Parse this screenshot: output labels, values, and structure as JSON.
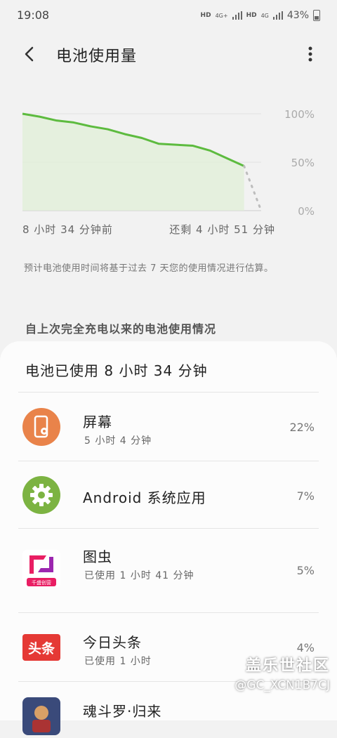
{
  "status_bar": {
    "time": "19:08",
    "network_1": "HD",
    "network_2": "4G+",
    "network_3": "HD",
    "network_4": "4G",
    "battery_percent": "43%"
  },
  "app_bar": {
    "title": "电池使用量",
    "back_icon": "back-arrow-icon",
    "more_icon": "more-vert-icon"
  },
  "chart_data": {
    "type": "line",
    "y_ticks": [
      "100%",
      "50%",
      "0%"
    ],
    "ylim": [
      0,
      100
    ],
    "series": [
      {
        "values": [
          100,
          97,
          93,
          91,
          87,
          84,
          79,
          75,
          69,
          68,
          67,
          62,
          54,
          46
        ]
      },
      {
        "values": [
          46,
          0
        ]
      }
    ],
    "caption_left": "8 小时 34 分钟前",
    "caption_right": "还剩 4 小时 51 分钟",
    "colors": {
      "used_line": "#5dbb3f",
      "forecast_line": "#bdbdbd",
      "fill": "#dff0d6"
    }
  },
  "estimate_note": "预计电池使用时间将基于过去 7 天您的使用情况进行估算。",
  "section_header": "自上次完全充电以来的电池使用情况",
  "usage_summary": "电池已使用 8 小时 34 分钟",
  "apps": [
    {
      "name": "屏幕",
      "detail": "5 小时 4 分钟",
      "percent": "22%",
      "icon": "screen-icon",
      "color": "#e9834a"
    },
    {
      "name": "Android 系统应用",
      "detail": "",
      "percent": "7%",
      "icon": "gear-icon",
      "color": "#7cb342"
    },
    {
      "name": "图虫",
      "detail": "已使用 1 小时 41 分钟",
      "percent": "5%",
      "icon": "tuchong-icon",
      "icon_text": "千盛创营",
      "color": "#e91e63"
    },
    {
      "name": "今日头条",
      "detail": "已使用 1 小时",
      "percent": "4%",
      "icon": "toutiao-icon",
      "icon_text": "头条",
      "color": "#e53935"
    },
    {
      "name": "魂斗罗·归来",
      "detail": "",
      "percent": "",
      "icon": "game-icon",
      "color": "#3a4a7a"
    }
  ],
  "watermark": {
    "brand": "盖乐世社区",
    "user": "@GC_XCN1B7CJ"
  }
}
